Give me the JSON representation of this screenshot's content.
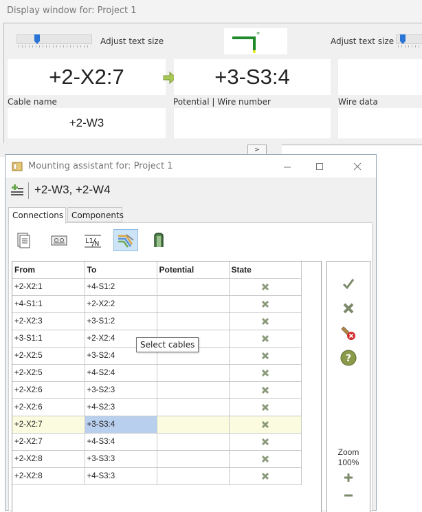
{
  "display_window": {
    "title": "Display window for: Project 1",
    "adjust_text_size_left": "Adjust text size",
    "adjust_text_size_right": "Adjust text size",
    "from_value": "+2-X2:7",
    "to_value": "+3-S3:4",
    "cable_name_label": "Cable name",
    "potential_label": "Potential  |  Wire number",
    "wire_data_label": "Wire data",
    "cable_name_value": "+2-W3",
    "strip_button": ">"
  },
  "mounting_assistant": {
    "title": "Mounting assistant for: Project 1",
    "cables": "+2-W3, +2-W4",
    "tabs": [
      {
        "label": "Connections",
        "active": true
      },
      {
        "label": "Components",
        "active": false
      }
    ],
    "toolbar": [
      "document-icon",
      "terminal-icon",
      "potential-icon",
      "select-cables-icon",
      "connector-icon"
    ],
    "tooltip": "Select cables",
    "columns": [
      "From",
      "To",
      "Potential",
      "State"
    ],
    "rows": [
      {
        "from": "+2-X2:1",
        "to": "+4-S1:2",
        "potential": ""
      },
      {
        "from": "+4-S1:1",
        "to": "+2-X2:2",
        "potential": ""
      },
      {
        "from": "+2-X2:3",
        "to": "+3-S1:2",
        "potential": ""
      },
      {
        "from": "+3-S1:1",
        "to": "+2-X2:4",
        "potential": ""
      },
      {
        "from": "+2-X2:5",
        "to": "+3-S2:4",
        "potential": ""
      },
      {
        "from": "+2-X2:5",
        "to": "+4-S2:4",
        "potential": ""
      },
      {
        "from": "+2-X2:6",
        "to": "+3-S2:3",
        "potential": ""
      },
      {
        "from": "+2-X2:6",
        "to": "+4-S2:3",
        "potential": ""
      },
      {
        "from": "+2-X2:7",
        "to": "+3-S3:4",
        "potential": "",
        "highlight": true
      },
      {
        "from": "+2-X2:7",
        "to": "+4-S3:4",
        "potential": ""
      },
      {
        "from": "+2-X2:8",
        "to": "+3-S3:3",
        "potential": ""
      },
      {
        "from": "+2-X2:8",
        "to": "+4-S3:3",
        "potential": ""
      }
    ],
    "zoom_label": "Zoom",
    "zoom_value": "100%",
    "colors": {
      "x_mark": "#8a9a7a",
      "check": "#7a8a6a",
      "selected_cell": "#b9cfee",
      "highlight_row": "#fbfbe0",
      "accent_blue": "#2a74d6"
    }
  }
}
